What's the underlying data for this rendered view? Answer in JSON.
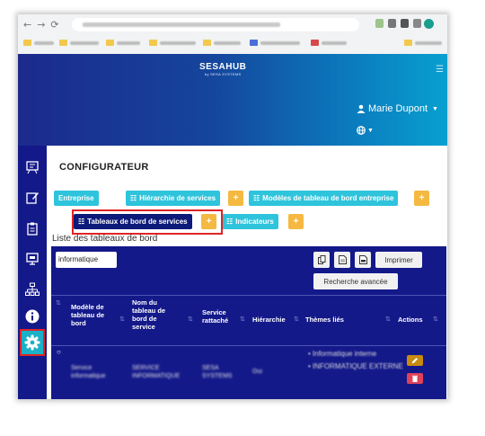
{
  "app": {
    "logo_main": "SESAHUB",
    "logo_sub": "by SESA SYSTEMS",
    "user_name": "Marie Dupont"
  },
  "page": {
    "title": "CONFIGURATEUR",
    "subtitle": "Liste des tableaux de bord"
  },
  "tabs": [
    {
      "label": "Entreprise"
    },
    {
      "label": "Hiérarchie de services"
    },
    {
      "label": "Modèles de tableau de bord entreprise"
    },
    {
      "label": "Tableaux de bord de services"
    },
    {
      "label": "Indicateurs"
    }
  ],
  "add_label": "+",
  "table": {
    "search_value": "informatique",
    "print_label": "Imprimer",
    "advanced_search_label": "Recherche avancée",
    "headers": {
      "model": "Modèle de tableau de bord",
      "name": "Nom du tableau de bord de service",
      "service": "Service rattaché",
      "hierarchy": "Hiérarchie",
      "themes": "Thèmes liés",
      "actions": "Actions"
    },
    "rows": [
      {
        "model": "Service informatique",
        "name": "SERVICE INFORMATIQUE",
        "service": "SESA SYSTEMS",
        "hierarchy": "Oui",
        "themes": [
          "Informatique interne",
          "INFORMATIQUE EXTERNE"
        ]
      }
    ]
  },
  "colors": {
    "accent_cyan": "#2ec4dc",
    "navy": "#14198a",
    "plus_orange": "#f5b942",
    "highlight_red": "#e02424",
    "edit_orange": "#c98a12",
    "delete_red": "#e04258"
  }
}
